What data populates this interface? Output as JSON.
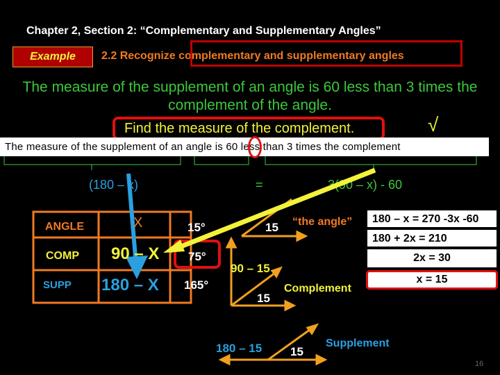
{
  "header": {
    "title": "Chapter 2, Section 2:  “Complementary and Supplementary Angles”",
    "example_label": "Example",
    "objective": "2.2  Recognize complementary and supplementary angles"
  },
  "problem": {
    "line1": "The measure of the supplement of an angle is 60 less than 3 times the",
    "line2": "complement of the angle.",
    "task": "Find the measure of the complement.",
    "check": "√"
  },
  "restated": "The measure of the supplement of an angle is 60 less than 3 times the complement",
  "equation": {
    "left": "(180 – x)",
    "equals": "=",
    "right": "3(90 – x) - 60"
  },
  "table": {
    "rows": [
      {
        "label": "ANGLE",
        "expr": "X",
        "value": "15°"
      },
      {
        "label": "COMP",
        "expr": "90 – X",
        "value": "75°"
      },
      {
        "label": "SUPP",
        "expr": "180 – X",
        "value": "165°"
      }
    ]
  },
  "diagrams": {
    "angle_value": "15",
    "angle_label": "“the angle”",
    "comp_expr": "90 – 15",
    "comp_value": "15",
    "comp_label": "Complement",
    "supp_expr": "180 – 15",
    "supp_value": "15",
    "supp_label": "Supplement"
  },
  "solution": [
    "180 – x = 270 -3x -60",
    "180 + 2x = 210",
    "2x = 30",
    "x = 15"
  ],
  "page_number": "16",
  "colors": {
    "green": "#3cc83c",
    "yellow": "#f2f23a",
    "orange": "#f07a22",
    "blue": "#2aa0e0",
    "red": "#e01010",
    "arrow": "#f0a020"
  }
}
